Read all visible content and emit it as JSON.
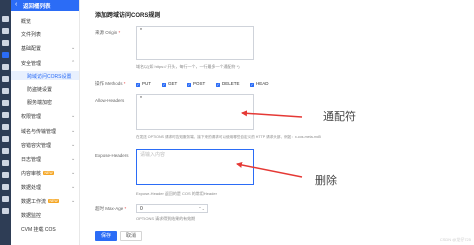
{
  "sidebar": {
    "title": "返回桶列表",
    "items": [
      {
        "label": "概览",
        "type": "item"
      },
      {
        "label": "文件列表",
        "type": "item"
      },
      {
        "label": "基础配置",
        "type": "group"
      },
      {
        "label": "安全管理",
        "type": "group"
      },
      {
        "label": "跨域访问CORS设置",
        "type": "sub",
        "active": true
      },
      {
        "label": "防盗链设置",
        "type": "sub"
      },
      {
        "label": "服务端加密",
        "type": "sub"
      },
      {
        "label": "权限管理",
        "type": "group"
      },
      {
        "label": "域名与传输管理",
        "type": "group"
      },
      {
        "label": "容错容灾管理",
        "type": "group"
      },
      {
        "label": "日志管理",
        "type": "group"
      },
      {
        "label": "内容审核",
        "type": "group",
        "badge": "NEW"
      },
      {
        "label": "数据处理",
        "type": "group"
      },
      {
        "label": "数据工作流",
        "type": "group",
        "badge": "NEW"
      },
      {
        "label": "数据监控",
        "type": "item"
      },
      {
        "label": "CVM 挂载 COS",
        "type": "item"
      }
    ]
  },
  "form": {
    "title": "添加跨域访问CORS规则",
    "origin": {
      "label": "来源 Origin",
      "value": "*",
      "hint": "域名以(如 https:// 开头，每行一个，一行最多一个通配符 *)"
    },
    "methods": {
      "label": "操作 Methods",
      "options": [
        "PUT",
        "GET",
        "POST",
        "DELETE",
        "HEAD"
      ]
    },
    "allow_headers": {
      "label": "Allow-Headers",
      "value": "*",
      "hint": "在发送 OPTIONS 请求时告知服务端，接下来的请求可以使用哪些自定义的 HTTP 请求头部，例如：x-cos-meta-md5"
    },
    "expose_headers": {
      "label": "Expose-Headers",
      "placeholder": "请输入内容",
      "hint": "Expose-Header 返回的是 COS 的常用Header"
    },
    "max_age": {
      "label": "超时 Max-Age",
      "value": "0",
      "hint": "OPTIONS 请求得到结果的有效期"
    },
    "save_label": "保存",
    "cancel_label": "取消"
  },
  "annotations": {
    "wildcard": "通配符",
    "delete": "删除"
  },
  "watermark": "CSDN @龙仔725",
  "colors": {
    "accent": "#2b6cf6",
    "rail": "#2e3d55",
    "arrow": "#e53935"
  }
}
